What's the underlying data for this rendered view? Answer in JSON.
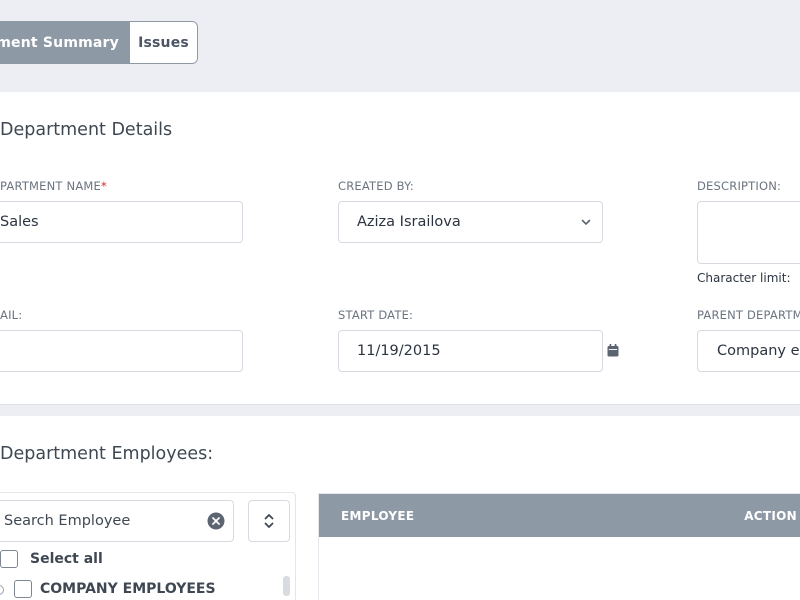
{
  "tabs": [
    {
      "label": "ment Summary",
      "active": true
    },
    {
      "label": "Issues",
      "active": false
    }
  ],
  "details": {
    "title": "Department Details",
    "department_name": {
      "label": "PARTMENT NAME",
      "required_mark": "*",
      "value": "Sales"
    },
    "created_by": {
      "label": "CREATED BY:",
      "value": "Aziza Israilova"
    },
    "description": {
      "label": "DESCRIPTION:",
      "value": "",
      "char_limit_label": "Character limit:"
    },
    "email": {
      "label": "AIL:",
      "value": ""
    },
    "start_date": {
      "label": "START DATE:",
      "value": "11/19/2015"
    },
    "parent_department": {
      "label": "PARENT DEPARTM",
      "value": "Company e"
    }
  },
  "employees": {
    "title": "Department Employees:",
    "search": {
      "placeholder": "Search Employee"
    },
    "select_all_label": "Select all",
    "group_label": "COMPANY EMPLOYEES",
    "table": {
      "columns": [
        "EMPLOYEE",
        "ACTION"
      ]
    }
  },
  "colors": {
    "accent": "#8e99a6",
    "required": "#e02424"
  }
}
